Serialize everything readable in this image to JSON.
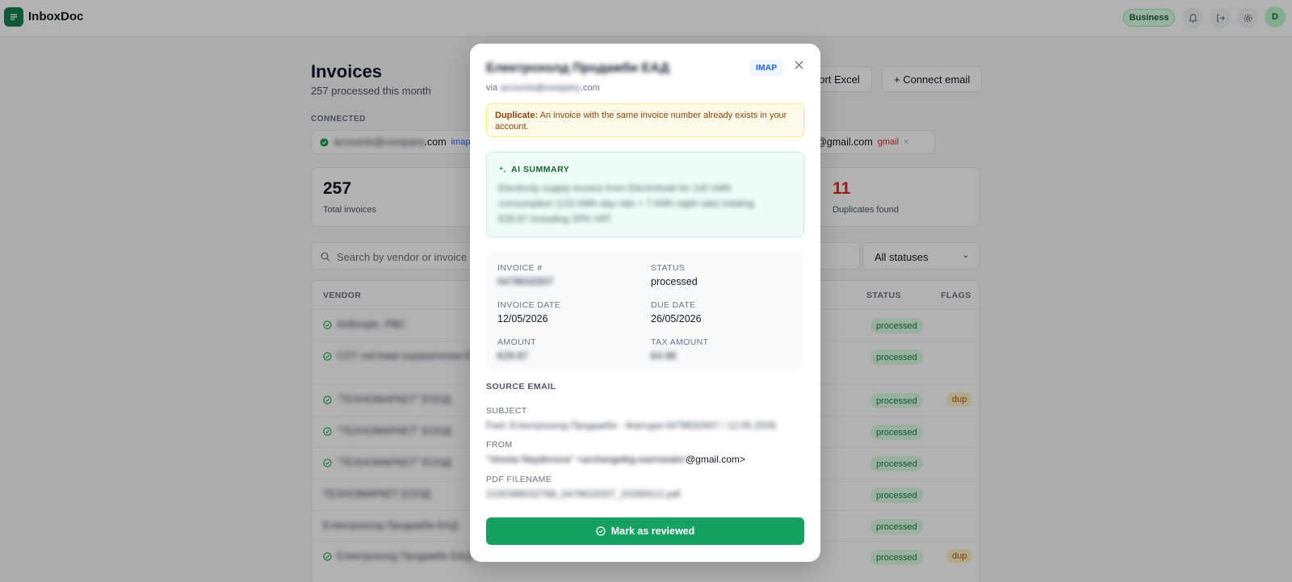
{
  "app": {
    "title": "InboxDoc",
    "plan_badge": "Business",
    "avatar_letter": "D"
  },
  "page": {
    "title": "Invoices",
    "subtitle": "257 processed this month",
    "export_label": "port Excel",
    "connect_label": "+ Connect email",
    "connected_label": "CONNECTED",
    "connections": [
      {
        "address_hidden": "accounts@company",
        "address_suffix": ".com",
        "type": "imap"
      },
      {
        "address_suffix": "er@gmail.com",
        "type": "gmail",
        "remove": "×"
      }
    ],
    "stats": [
      {
        "value": "257",
        "label": "Total invoices"
      },
      {
        "value": "11",
        "label": "Duplicates found"
      }
    ],
    "search_placeholder": "Search by vendor or invoice #",
    "status_filter": "All statuses",
    "table": {
      "headers": {
        "vendor": "VENDOR",
        "status": "STATUS",
        "flags": "FLAGS"
      },
      "rows": [
        {
          "vendor": "Anthropic, PBC",
          "status": "processed",
          "flag": "",
          "frag": ""
        },
        {
          "vendor": "СОТ системи охранителни ЕООД",
          "status": "processed",
          "flag": "",
          "frag": ""
        },
        {
          "vendor": "\"ТЕХНОМАРКЕТ\" ЕООД",
          "status": "processed",
          "flag": "dup",
          "frag": "0"
        },
        {
          "vendor": "\"ТЕХНОМАРКЕТ\" ЕООД",
          "status": "processed",
          "flag": "",
          "frag": "0"
        },
        {
          "vendor": "\"ТЕХНОМАРКЕТ\" ЕООД",
          "status": "processed",
          "flag": "",
          "frag": "0"
        },
        {
          "vendor": "ТЕХНОМАРКЕТ ЕООД",
          "status": "processed",
          "flag": "",
          "frag": "0"
        },
        {
          "vendor": "Електрохолд Продажби ЕАД",
          "status": "processed",
          "flag": "",
          "frag": ""
        },
        {
          "vendor": "Електрохолд Продажби ЕАД",
          "status": "processed",
          "flag": "dup",
          "frag": ""
        }
      ]
    }
  },
  "modal": {
    "vendor": "Електрохолд Продажби ЕАД",
    "via_prefix": "via",
    "via_hidden": "accounts@company",
    "via_suffix": ".com",
    "source_badge": "IMAP",
    "alert_title": "Duplicate:",
    "alert_text": " An invoice with the same invoice number already exists in your account.",
    "ai_title": "AI SUMMARY",
    "ai_text": "Electricity supply invoice from Electrohold for 142 kWh consumption (122 kWh day rate + 7 kWh night rate) totaling €29.87 including 20% VAT.",
    "fields": {
      "invoice_no_label": "INVOICE #",
      "invoice_no": "0478632007",
      "status_label": "STATUS",
      "status": "processed",
      "invoice_date_label": "INVOICE DATE",
      "invoice_date": "12/05/2026",
      "due_date_label": "DUE DATE",
      "due_date": "26/05/2026",
      "amount_label": "AMOUNT",
      "amount": "€29.87",
      "tax_label": "TAX AMOUNT",
      "tax": "€4.98"
    },
    "source": {
      "title": "SOURCE EMAIL",
      "subject_label": "SUBJECT",
      "subject": "Fwd: Електрохолд Продажби - Фактура 0478632007 / 12.05.2026",
      "from_label": "FROM",
      "from_hidden": "\"Vesela Naydenova\" <archangelbg.warmwater",
      "from_suffix": "@gmail.com>",
      "pdf_label": "PDF FILENAME",
      "pdf": "2150398032788_0478632007_20260512.pdf"
    },
    "action_label": "Mark as reviewed"
  },
  "colors": {
    "brand": "#16804f",
    "accent_button": "#16a163",
    "duplicate_red": "#dc2626",
    "imap_blue": "#2563eb"
  }
}
